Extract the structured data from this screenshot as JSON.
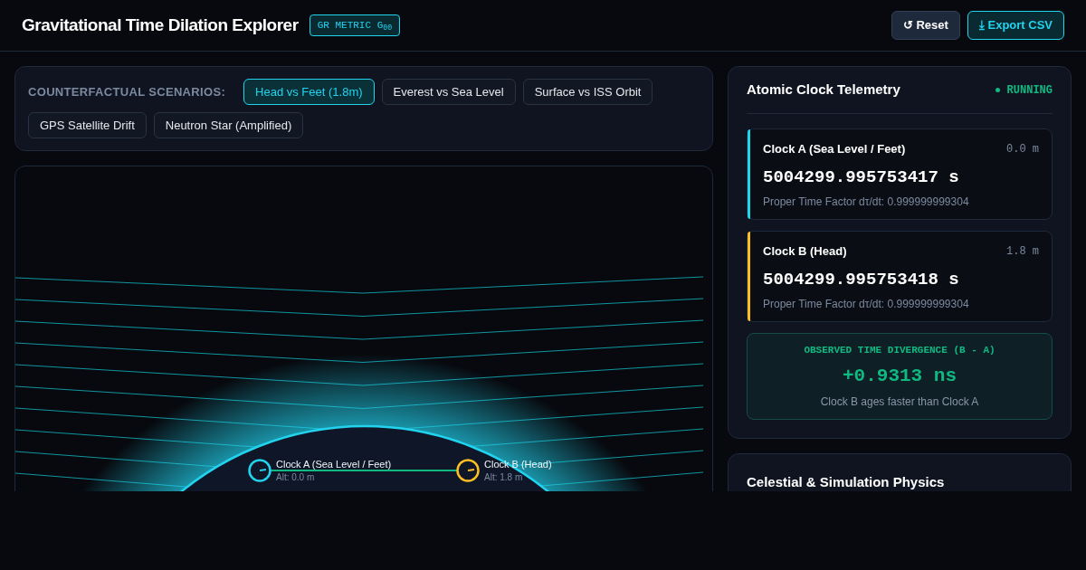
{
  "header": {
    "title": "Gravitational Time Dilation Explorer",
    "badge": "GR METRIC G$_{00}$",
    "buttons": [
      {
        "kind": "secondary",
        "label": "↺ Reset"
      },
      {
        "kind": "primary",
        "label": "⤓ Export CSV"
      }
    ]
  },
  "scenarios": {
    "label": "COUNTERFACTUAL SCENARIOS:",
    "items": [
      {
        "label": "Head vs Feet (1.8m)",
        "selected": true
      },
      {
        "label": "Everest vs Sea Level",
        "selected": false
      },
      {
        "label": "Surface vs ISS Orbit",
        "selected": false
      },
      {
        "label": "GPS Satellite Drift",
        "selected": false
      },
      {
        "label": "Neutron Star (Amplified)",
        "selected": false
      }
    ]
  },
  "visualization": {
    "clocks": [
      {
        "label": "Clock A (Sea Level / Feet)",
        "altitude": "Alt: 0.0 m",
        "color": "#22d3ee"
      },
      {
        "label": "Clock B (Head)",
        "altitude": "Alt: 1.8 m",
        "color": "#fbbf24"
      }
    ]
  },
  "telemetry": {
    "title": "Atomic Clock Telemetry",
    "status": {
      "label": "RUNNING",
      "running": true
    },
    "clocks": [
      {
        "name": "Clock A (Sea Level / Feet)",
        "altitude": "0.0 m",
        "time": "5004299.995753417 s",
        "factor": "Proper Time Factor dτ/dt: 0.999999999304",
        "color": "#22d3ee"
      },
      {
        "name": "Clock B (Head)",
        "altitude": "1.8 m",
        "time": "5004299.995753418 s",
        "factor": "Proper Time Factor dτ/dt: 0.999999999304",
        "color": "#fbbf24"
      }
    ],
    "divergence": {
      "label": "OBSERVED TIME DIVERGENCE (B - A)",
      "value": "+0.9313 ns",
      "note": "Clock B ages faster than Clock A"
    }
  },
  "physics": {
    "title": "Celestial & Simulation Physics"
  }
}
